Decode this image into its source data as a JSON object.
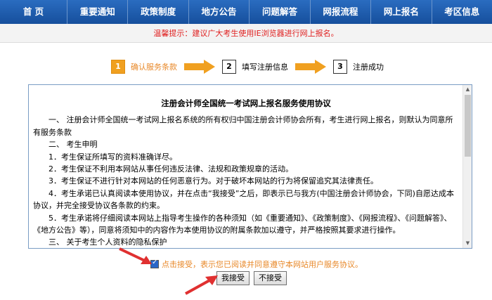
{
  "nav": {
    "items": [
      "首 页",
      "重要通知",
      "政策制度",
      "地方公告",
      "问题解答",
      "网报流程",
      "网上报名",
      "考区信息"
    ]
  },
  "tip": "温馨提示：建议广大考生使用IE浏览器进行网上报名。",
  "steps": [
    {
      "num": "1",
      "label": "确认服务条款",
      "active": true
    },
    {
      "num": "2",
      "label": "填写注册信息",
      "active": false
    },
    {
      "num": "3",
      "label": "注册成功",
      "active": false
    }
  ],
  "agreement": {
    "title": "注册会计师全国统一考试网上报名服务使用协议",
    "paragraphs": [
      "一、 注册会计师全国统一考试网上报名系统的所有权归中国注册会计师协会所有，考生进行网上报名，则默认为同意所有服务条款",
      "二、 考生申明",
      "1．考生保证所填写的资料准确详尽。",
      "2．考生保证不利用本网站从事任何违反法律、法规和政策规章的活动。",
      "3．考生保证不进行针对本网站的任何恶意行为。对于破坏本网站的行为将保留追究其法律责任。",
      "4．考生承诺已认真阅读本使用协议，并在点击“我接受”之后，即表示已与我方(中国注册会计师协会，下同)自愿达成本协议，并完全接受协议各条款的约束。",
      "5．考生承诺将仔细阅读本网站上指导考生操作的各种须知（如《重要通知》、《政策制度》、《网报流程》、《问题解答》、《地方公告》等），同意将须知中的内容作为本使用协议的附属条款加以遵守，并严格按照其要求进行操作。",
      "三、 关于考生个人资料的隐私保护"
    ]
  },
  "accept_text": "点击接受，表示您已阅读并同意遵守本网站用户服务协议。",
  "buttons": {
    "accept": "我接受",
    "reject": "不接受"
  },
  "colors": {
    "nav": "#1d5aa8",
    "tip": "#e02020",
    "accent": "#e8892a",
    "step_active": "#f0a020",
    "annotation": "#e03030"
  }
}
